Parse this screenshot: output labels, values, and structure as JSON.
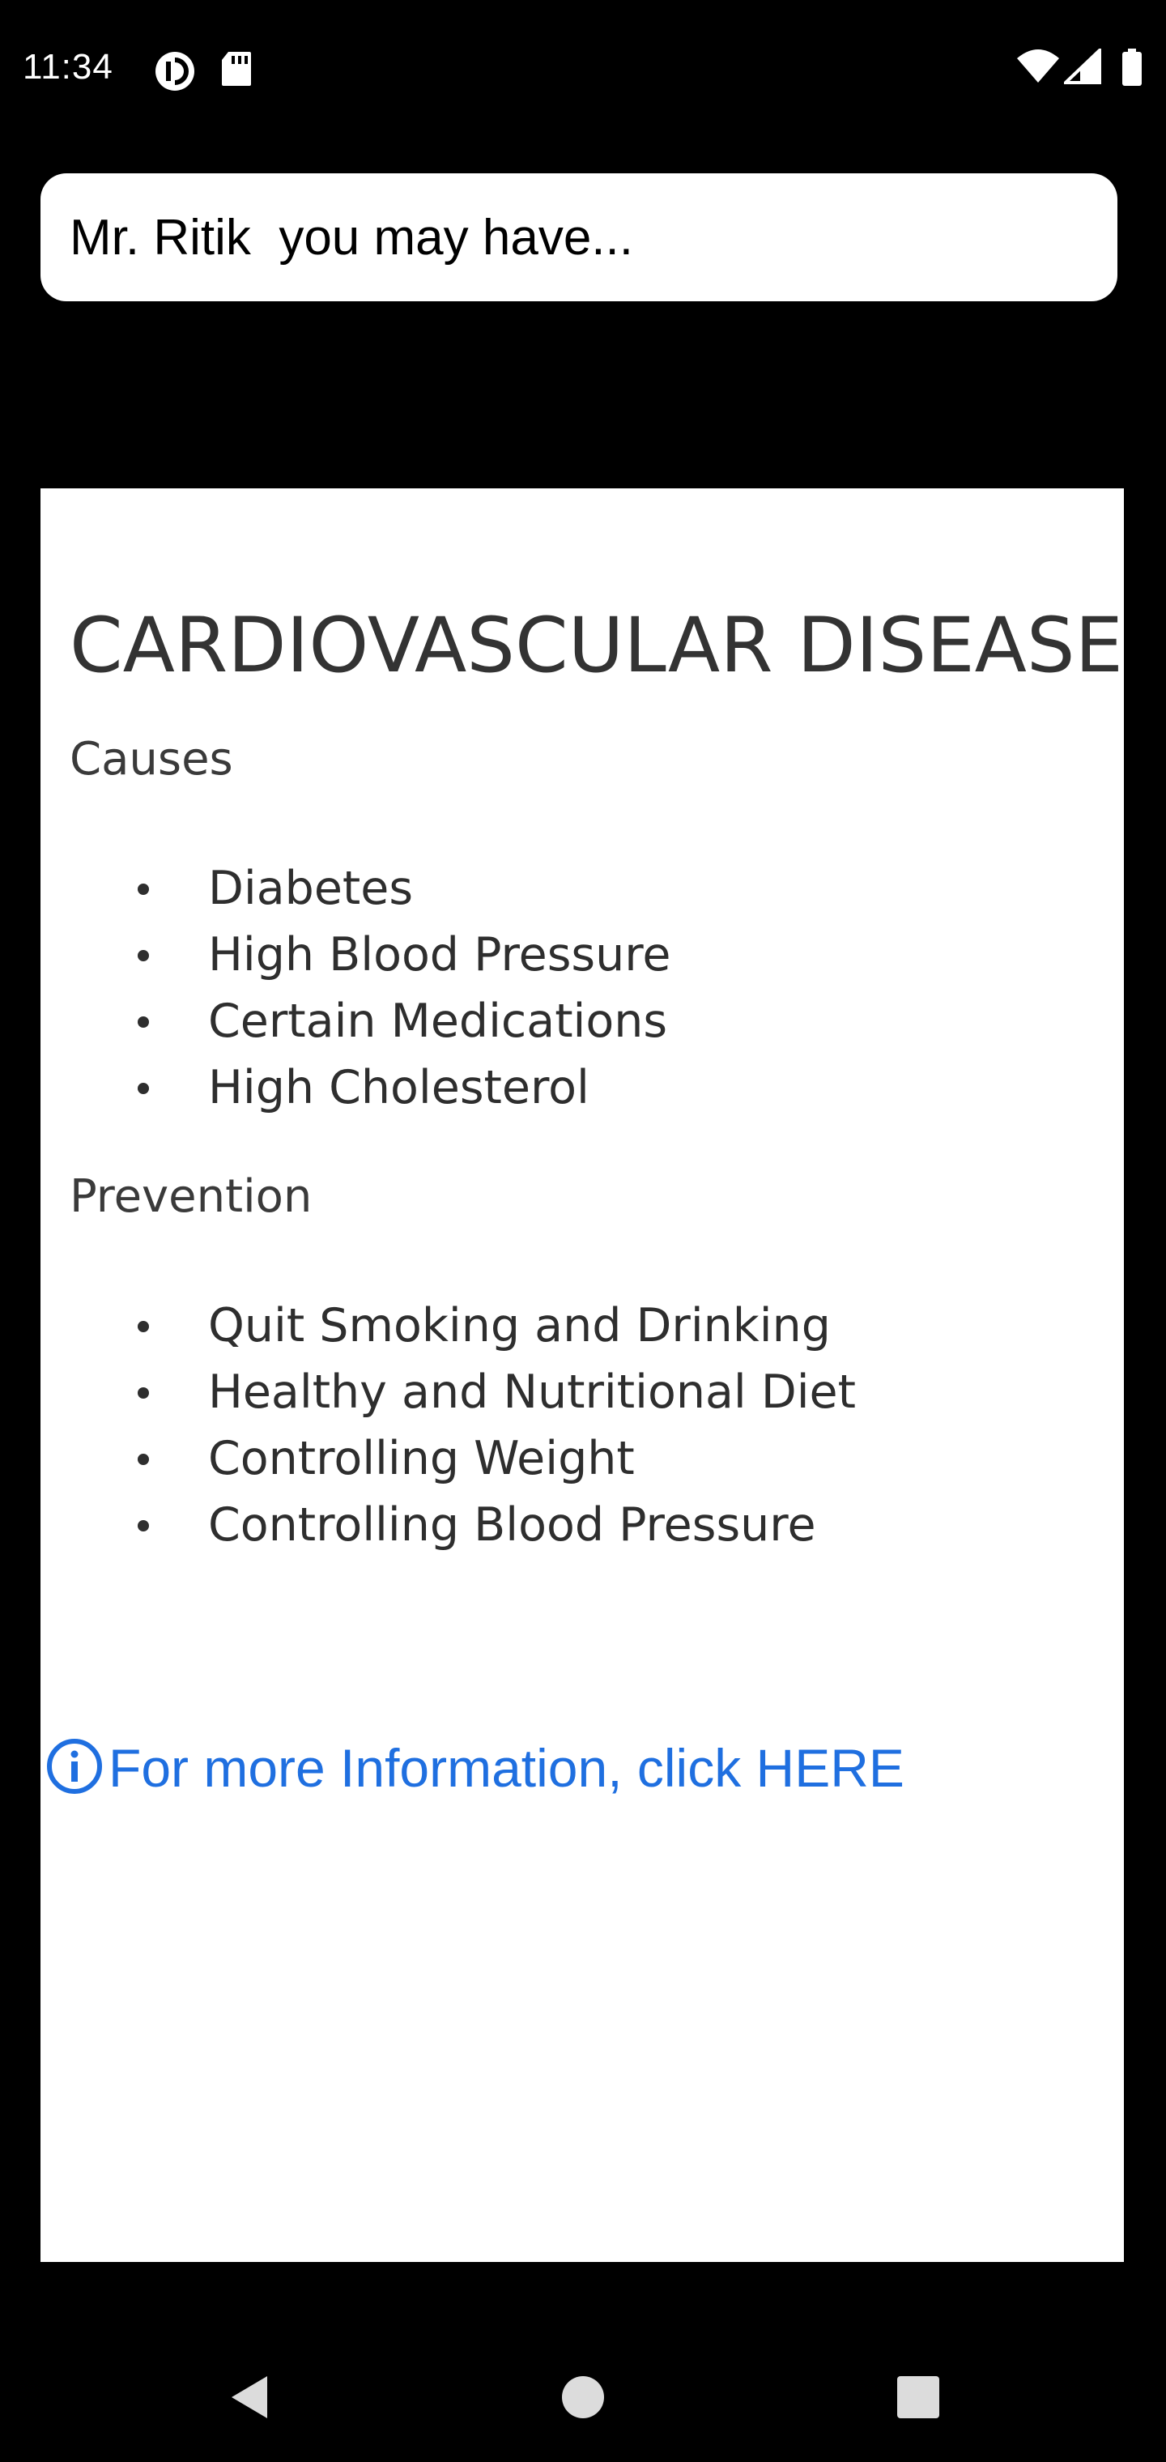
{
  "status_bar": {
    "time": "11:34",
    "left_icons": [
      "sync-icon",
      "sd-card-icon"
    ],
    "right_icons": [
      "wifi-icon",
      "cell-signal-icon",
      "battery-icon"
    ]
  },
  "message": {
    "text": "Mr. Ritik  you may have..."
  },
  "disease": {
    "title": "CARDIOVASCULAR DISEASE",
    "causes_heading": "Causes",
    "causes": [
      "Diabetes",
      "High Blood Pressure",
      "Certain Medications",
      "High Cholesterol"
    ],
    "prevention_heading": "Prevention",
    "prevention": [
      "Quit Smoking and Drinking",
      "Healthy and Nutritional Diet",
      "Controlling Weight",
      "Controlling Blood Pressure"
    ]
  },
  "more_info": {
    "label": "For more Information, click HERE",
    "icon": "info-icon",
    "color": "#1f6fe0"
  },
  "nav_bar": {
    "buttons": [
      "back-icon",
      "home-icon",
      "recents-icon"
    ]
  },
  "colors": {
    "background": "#000000",
    "card": "#ffffff",
    "link": "#1f6fe0"
  }
}
